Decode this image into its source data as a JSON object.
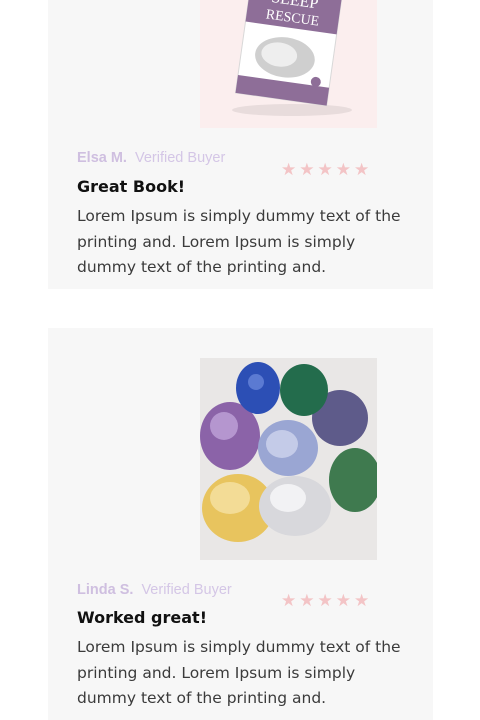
{
  "reviews": [
    {
      "reviewer": "Elsa M.",
      "verified_label": "Verified Buyer",
      "title": "Great Book!",
      "body": "Lorem Ipsum is simply dummy text of the printing and. Lorem Ipsum is simply dummy text of the printing and.",
      "rating": 5,
      "stars": "★★★★★",
      "book_cover_text": "SLEEP RESCUE"
    },
    {
      "reviewer": "Linda S.",
      "verified_label": "Verified Buyer",
      "title": "Worked great!",
      "body": "Lorem Ipsum is simply dummy text of the printing and. Lorem Ipsum is simply dummy text of the printing and.",
      "rating": 5,
      "stars": "★★★★★"
    }
  ],
  "colors": {
    "card_bg": "#f7f7f7",
    "reviewer": "#cfbfe0",
    "star": "#f3c4c6",
    "book_band": "#8e6e98"
  }
}
